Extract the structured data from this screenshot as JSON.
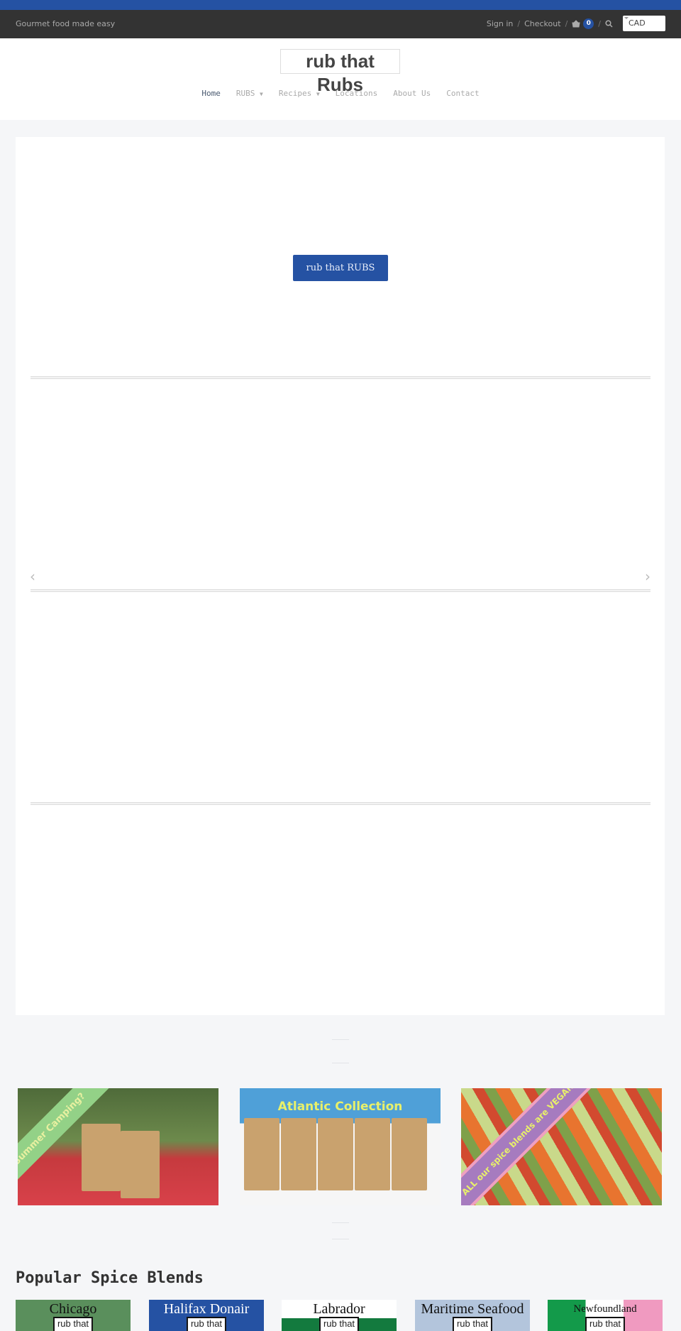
{
  "topbar": {
    "tagline": "Gourmet food made easy",
    "sign_in": "Sign in",
    "checkout": "Checkout",
    "cart_count": "0",
    "currency": "CAD",
    "separator": "/"
  },
  "header": {
    "logo": "rub that Rubs",
    "nav": [
      {
        "label": "Home",
        "active": true
      },
      {
        "label": "RUBS",
        "dropdown": true
      },
      {
        "label": "Recipes",
        "dropdown": true
      },
      {
        "label": "Locations"
      },
      {
        "label": "About Us"
      },
      {
        "label": "Contact"
      }
    ]
  },
  "hero": {
    "button_label": "rub that RUBS",
    "prev_icon": "chevron-left-icon",
    "next_icon": "chevron-right-icon"
  },
  "promos": [
    {
      "ribbon": "Summer Camping?",
      "ribbon_color": "#93d187"
    },
    {
      "title": "Atlantic Collection",
      "bg_color": "#4fa0d8"
    },
    {
      "ribbon": "ALL our spice blends are VEGAN",
      "ribbon_color": "#a67bbf"
    }
  ],
  "popular": {
    "title": "Popular Spice Blends",
    "brand": "rub that",
    "items": [
      {
        "name": "Chicago",
        "color": "#5a8f5c"
      },
      {
        "name": "Halifax Donair",
        "color": "#2552a3"
      },
      {
        "name": "Labrador",
        "color": "#ffffff"
      },
      {
        "name": "Maritime Seafood",
        "color": "#b3c5dc"
      },
      {
        "name": "Newfoundland",
        "color": "#139a4a"
      }
    ]
  },
  "colors": {
    "accent": "#2552a3",
    "topbar": "#333333",
    "page_bg": "#f5f6f8"
  }
}
